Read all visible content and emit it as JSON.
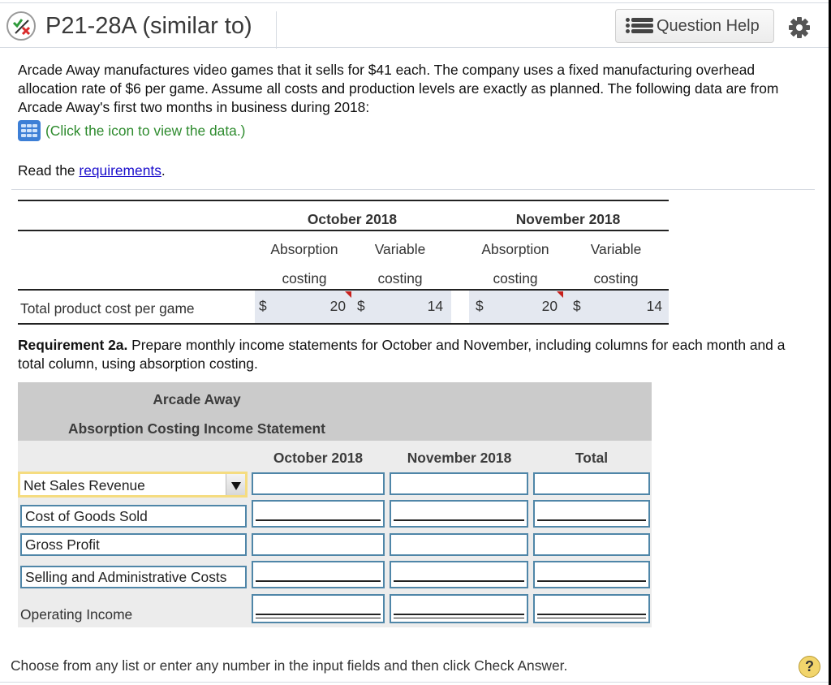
{
  "header": {
    "title": "P21-28A (similar to)",
    "status_icon": "partially-correct-icon",
    "question_help_label": "Question Help",
    "settings_icon": "gear-icon"
  },
  "intro": {
    "text": "Arcade Away manufactures video games that it sells for $41 each. The company uses a fixed manufacturing overhead allocation rate of $6 per game. Assume all costs and production levels are exactly as planned. The following data are from Arcade Away's first two months in business during 2018:",
    "data_link": "(Click the icon to view the data.)",
    "read_prefix": "Read the ",
    "requirements_link": "requirements",
    "read_suffix": "."
  },
  "cost_table": {
    "months": [
      "October 2018",
      "November 2018"
    ],
    "col_line1": [
      "Absorption",
      "Variable",
      "Absorption",
      "Variable"
    ],
    "col_line2": [
      "costing",
      "costing",
      "costing",
      "costing"
    ],
    "row_label": "Total product cost per game",
    "currency": "$",
    "values": [
      "20",
      "14",
      "20",
      "14"
    ]
  },
  "requirement": {
    "bold": "Requirement 2a.",
    "text": " Prepare monthly income statements for October and November, including columns for each month and a total column, using absorption costing."
  },
  "income_statement": {
    "company": "Arcade Away",
    "title": "Absorption Costing Income Statement",
    "columns": [
      "October 2018",
      "November 2018",
      "Total"
    ],
    "rows": [
      {
        "label": "Net Sales Revenue",
        "type": "select",
        "values": [
          "",
          "",
          ""
        ]
      },
      {
        "label": "Cost of Goods Sold",
        "type": "input",
        "values": [
          "",
          "",
          ""
        ]
      },
      {
        "label": "Gross Profit",
        "type": "input",
        "values": [
          "",
          "",
          ""
        ]
      },
      {
        "label": "Selling and Administrative Costs",
        "type": "input",
        "values": [
          "",
          "",
          ""
        ]
      },
      {
        "label": "Operating Income",
        "type": "static",
        "values": [
          "",
          "",
          ""
        ]
      }
    ]
  },
  "footer": {
    "instruction": "Choose from any list or enter any number in the input fields and then click Check Answer.",
    "help_label": "?"
  }
}
